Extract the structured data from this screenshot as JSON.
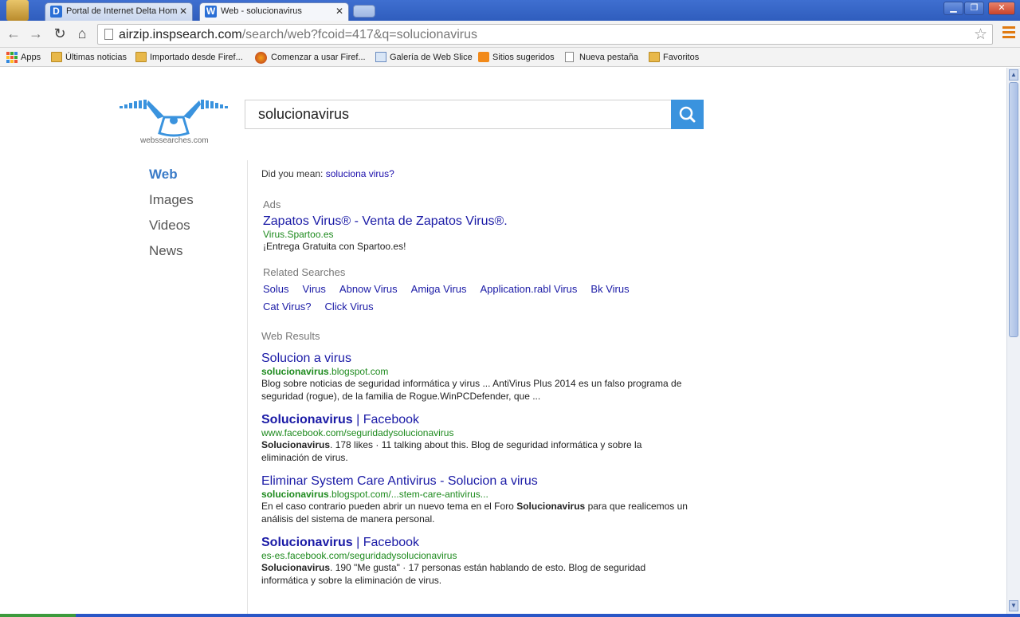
{
  "tabs": [
    {
      "label": "Portal de Internet Delta Hom",
      "favicon": "D",
      "color": "#2a6fd6",
      "active": false
    },
    {
      "label": "Web - solucionavirus",
      "favicon": "W",
      "color": "#2a6fd6",
      "active": true
    }
  ],
  "toolbar": {
    "url_host": "airzip.inspsearch.com",
    "url_path": "/search/web?fcoid=417&q=solucionavirus"
  },
  "bookmarks": [
    {
      "label": "Apps",
      "icon": "apps-grid-icon"
    },
    {
      "label": "Últimas noticias",
      "icon": "folder-icon"
    },
    {
      "label": "Importado desde Firef...",
      "icon": "folder-icon"
    },
    {
      "label": "Comenzar a usar Firef...",
      "icon": "firefox-icon"
    },
    {
      "label": "Galería de Web Slice",
      "icon": "webslice-icon"
    },
    {
      "label": "Sitios sugeridos",
      "icon": "sites-icon"
    },
    {
      "label": "Nueva pestaña",
      "icon": "page-icon"
    },
    {
      "label": "Favoritos",
      "icon": "folder-icon"
    }
  ],
  "logo_text": "webssearches.com",
  "search": {
    "query": "solucionavirus"
  },
  "leftnav": [
    "Web",
    "Images",
    "Videos",
    "News"
  ],
  "dym": {
    "prefix": "Did you mean:",
    "suggestion": "soluciona virus?"
  },
  "ads": {
    "label": "Ads",
    "title": "Zapatos Virus® - Venta de Zapatos Virus®.",
    "url": "Virus.Spartoo.es",
    "desc": "¡Entrega Gratuita con Spartoo.es!"
  },
  "related": {
    "label": "Related Searches",
    "row1": [
      "Solus",
      "Virus",
      "Abnow Virus",
      "Amiga Virus",
      "Application.rabl Virus",
      "Bk Virus"
    ],
    "row2": [
      "Cat Virus?",
      "Click Virus"
    ]
  },
  "web_label": "Web Results",
  "results": [
    {
      "title_bold": "",
      "title": "Solucion a virus",
      "url_bold": "solucionavirus",
      "url": ".blogspot.com",
      "snippet": "Blog sobre noticias de seguridad informática y virus ... AntiVirus Plus 2014 es un falso programa de seguridad (rogue), de la familia de Rogue.WinPCDefender, que ..."
    },
    {
      "title_bold": "Solucionavirus",
      "title": " | Facebook",
      "url_bold": "",
      "url": "www.facebook.com/seguridadysolucionavirus",
      "snippet": "Solucionavirus. 178 likes · 11 talking about this. Blog de seguridad informática y sobre la eliminación de virus."
    },
    {
      "title_bold": "",
      "title": "Eliminar System Care Antivirus - Solucion a virus",
      "url_bold": "solucionavirus",
      "url": ".blogspot.com/...stem-care-antivirus...",
      "snippet": "En el caso contrario pueden abrir un nuevo tema en el Foro Solucionavirus para que realicemos un análisis del sistema de manera personal."
    },
    {
      "title_bold": "Solucionavirus",
      "title": " | Facebook",
      "url_bold": "",
      "url": "es-es.facebook.com/seguridadysolucionavirus",
      "snippet": "Solucionavirus. 190 \"Me gusta\" · 17 personas están hablando de esto. Blog de seguridad informática y sobre la eliminación de virus."
    }
  ]
}
